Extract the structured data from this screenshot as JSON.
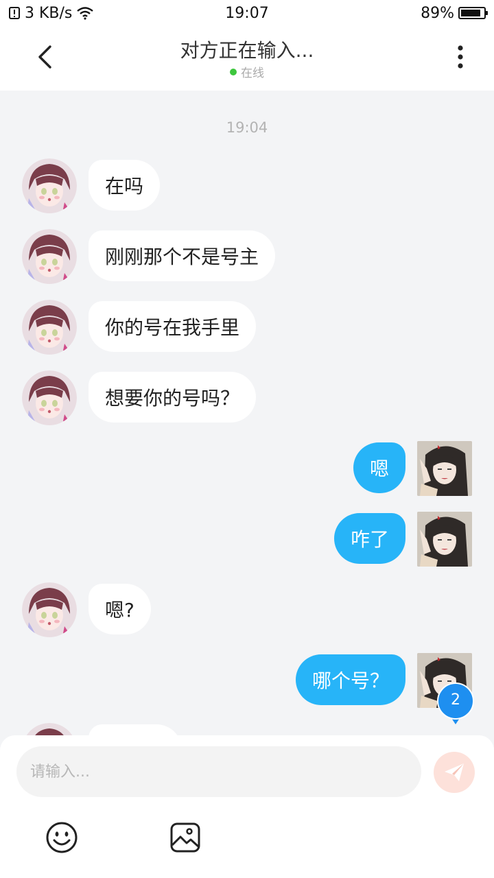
{
  "status_bar": {
    "network_speed": "3 KB/s",
    "time": "19:07",
    "battery": "89%",
    "battery_level": 0.89,
    "icons": [
      "notification-icon",
      "wifi-icon",
      "battery-icon"
    ]
  },
  "header": {
    "title": "对方正在输入...",
    "online_status": "在线",
    "online_color": "#3dc63d",
    "icons": [
      "back-arrow-icon",
      "more-vertical-icon"
    ]
  },
  "chat": {
    "timestamp": "19:04",
    "messages": [
      {
        "side": "left",
        "text": "在吗"
      },
      {
        "side": "left",
        "text": "刚刚那个不是号主"
      },
      {
        "side": "left",
        "text": "你的号在我手里"
      },
      {
        "side": "left",
        "text": "想要你的号吗？"
      },
      {
        "side": "right",
        "text": "嗯"
      },
      {
        "side": "right",
        "text": "咋了"
      },
      {
        "side": "left",
        "text": "嗯?"
      },
      {
        "side": "right",
        "text": "哪个号？"
      }
    ],
    "unread_badge": "2",
    "colors": {
      "outgoing_bubble": "#27b4f8",
      "incoming_bubble": "#ffffff",
      "badge": "#1e8ff0"
    }
  },
  "composer": {
    "placeholder": "请输入...",
    "icons": [
      "send-icon",
      "emoji-icon",
      "image-icon"
    ]
  }
}
